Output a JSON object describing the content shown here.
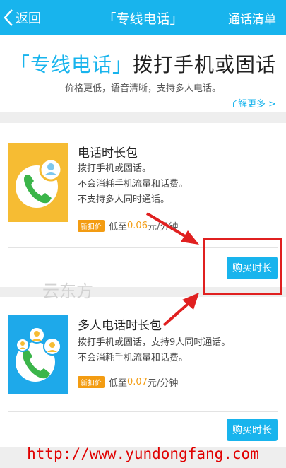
{
  "nav": {
    "back_label": "返回",
    "title": "「专线电话」",
    "right_label": "通话清单"
  },
  "banner": {
    "title_highlight": "「专线电话」",
    "title_rest": "拨打手机或固话",
    "subtitle": "价格更低，语音清晰，支持多人电话。",
    "more_link": "了解更多 >"
  },
  "packages": [
    {
      "title": "电话时长包",
      "desc": [
        "拨打手机或固话。",
        "不会消耗手机流量和话费。",
        "不支持多人同时通话。"
      ],
      "badge": "新扣价",
      "price_prefix": "低至",
      "price": "0.06",
      "price_suffix": "元/分钟",
      "button": "购买时长",
      "icon": "phone-single-icon"
    },
    {
      "title": "多人电话时长包",
      "desc": [
        "拨打手机或固话，支持9人同时通话。",
        "不会消耗手机流量和话费。"
      ],
      "badge": "新扣价",
      "price_prefix": "低至",
      "price": "0.07",
      "price_suffix": "元/分钟",
      "button": "购买时长",
      "icon": "phone-multi-icon"
    }
  ],
  "watermark": "云东方",
  "footer_url": "http://www.yundongfang.com",
  "colors": {
    "accent": "#18b4ed",
    "price": "#f39c12",
    "annotation": "#e02020",
    "card1_icon_bg": "#f6bc33",
    "card2_icon_bg": "#1ea9ea"
  }
}
